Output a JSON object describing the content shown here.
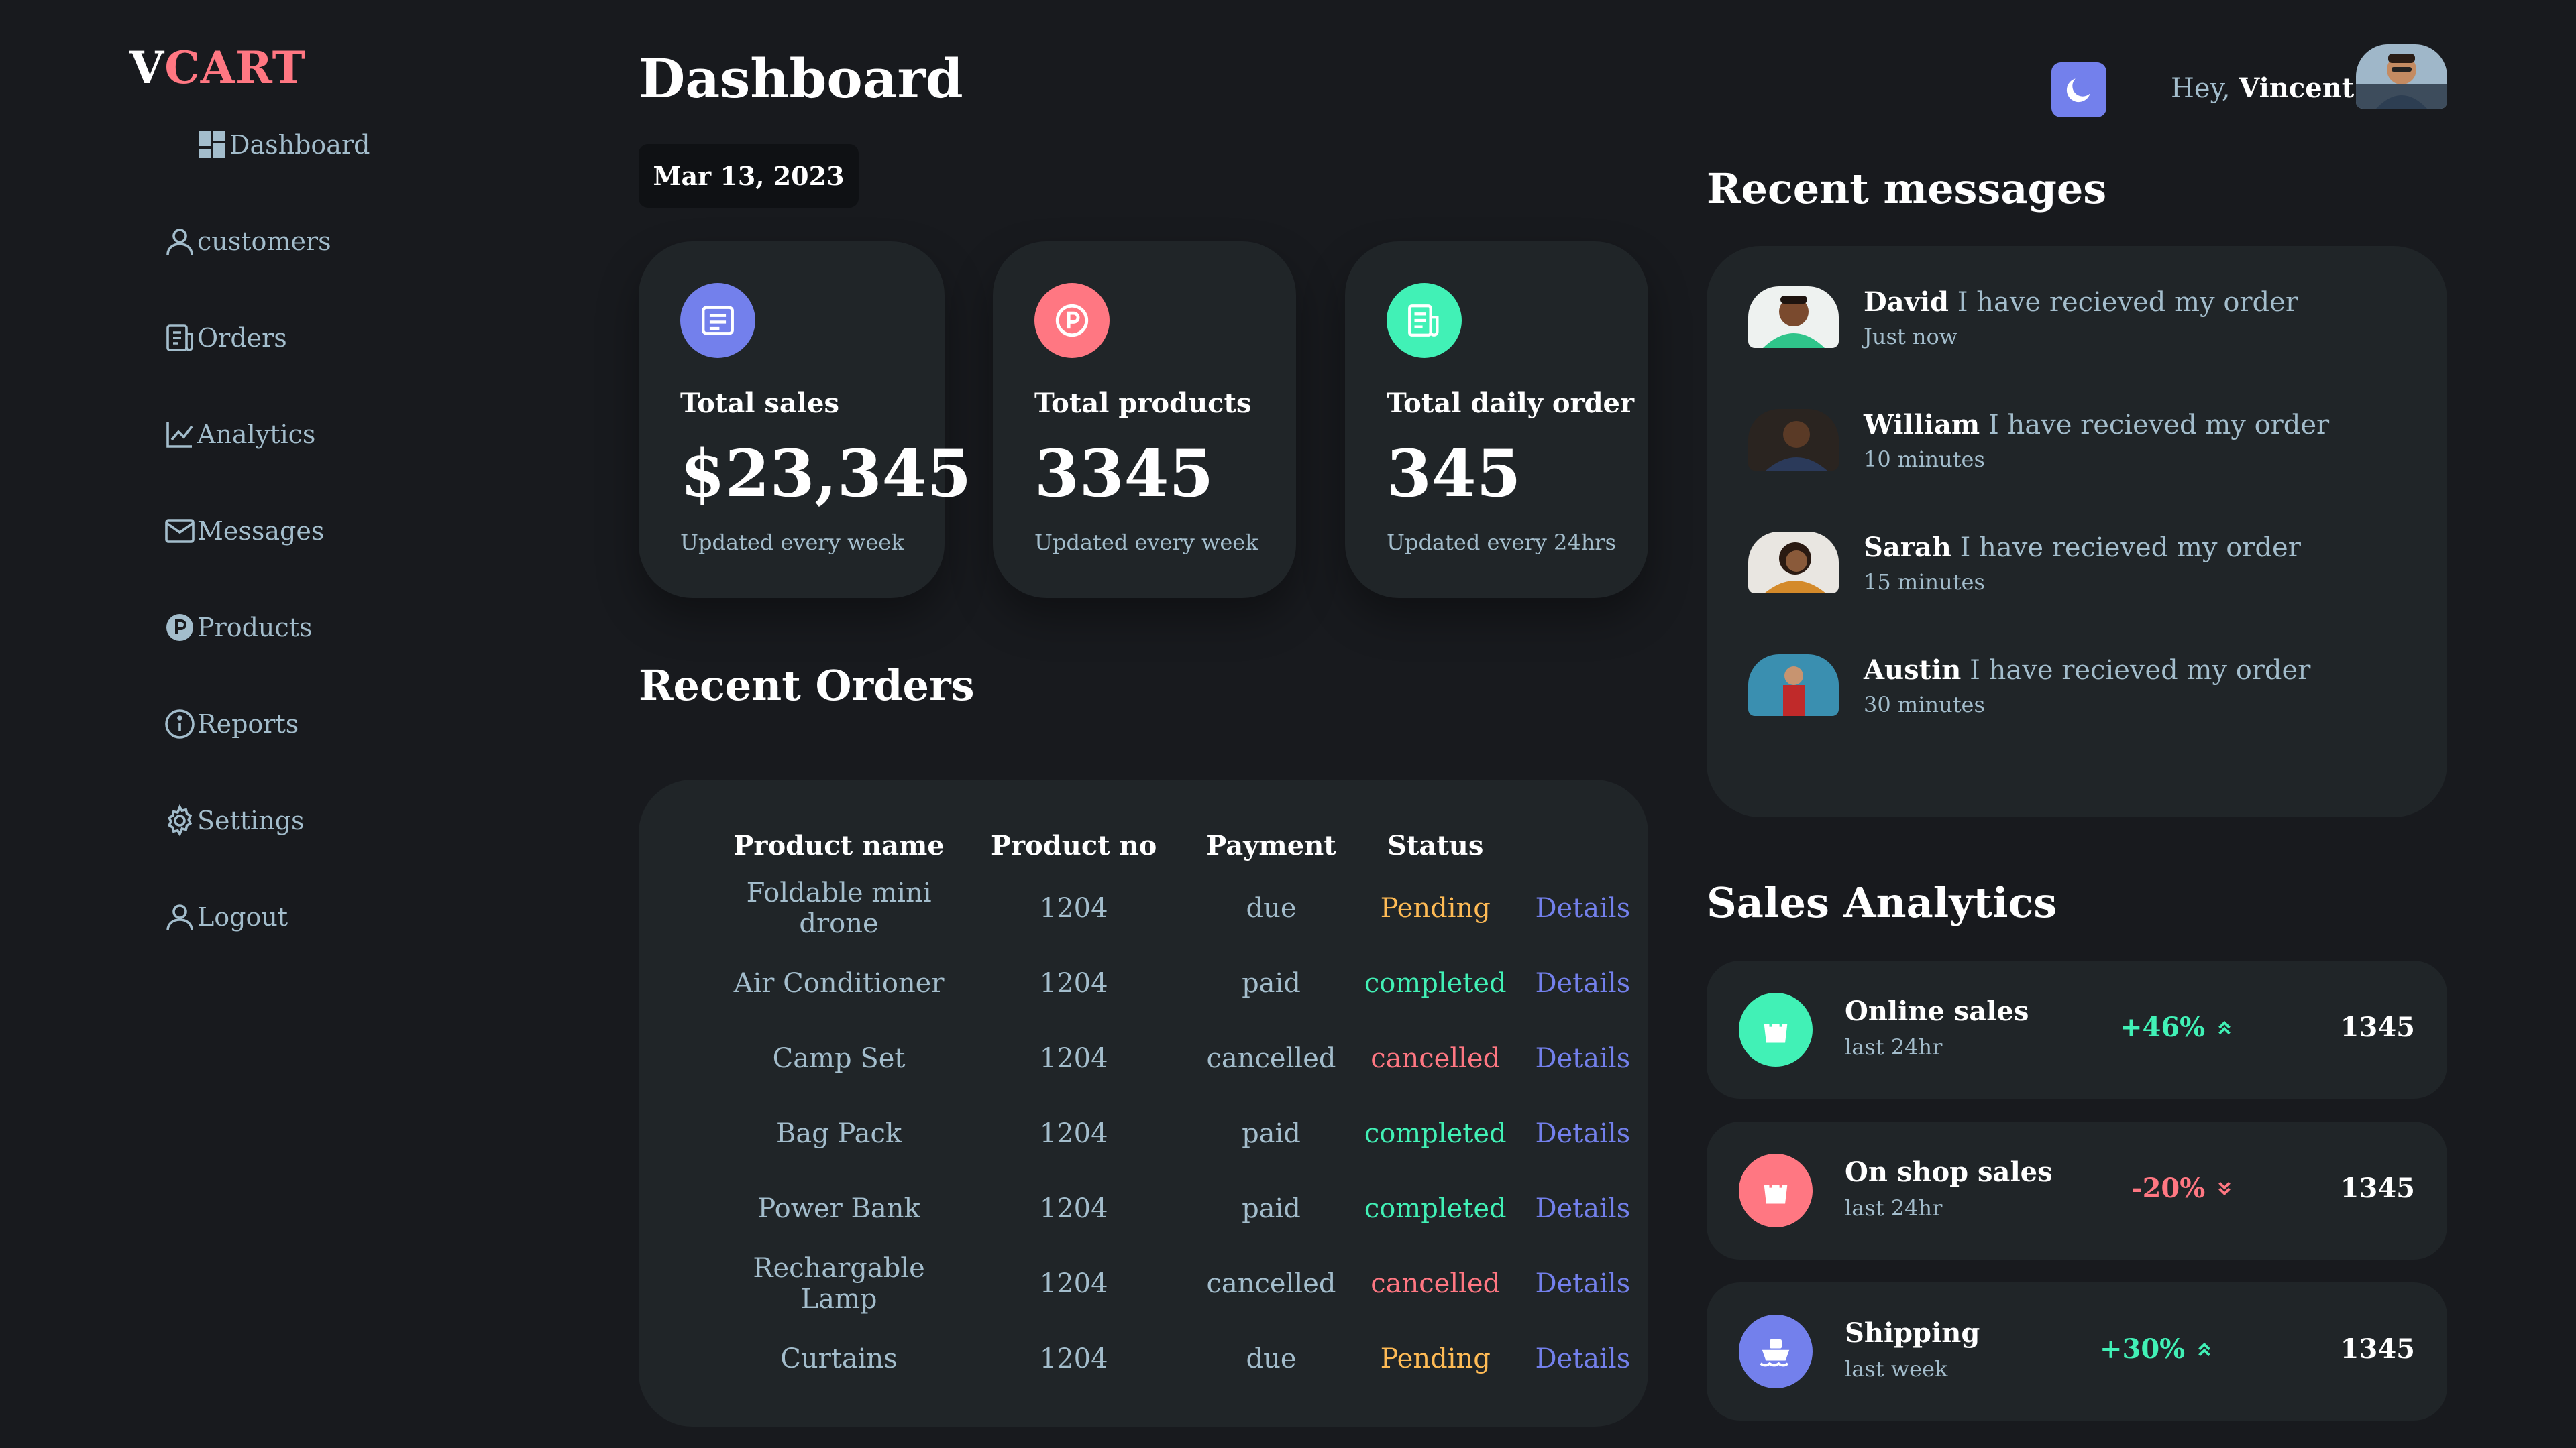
{
  "brand": {
    "prefix": "V",
    "suffix": "CART"
  },
  "sidebar": {
    "items": [
      {
        "label": "Dashboard",
        "icon": "grid-icon"
      },
      {
        "label": "customers",
        "icon": "user-icon"
      },
      {
        "label": "Orders",
        "icon": "receipt-icon"
      },
      {
        "label": "Analytics",
        "icon": "chart-icon"
      },
      {
        "label": "Messages",
        "icon": "mail-icon"
      },
      {
        "label": "Products",
        "icon": "product-p-icon"
      },
      {
        "label": "Reports",
        "icon": "info-icon"
      },
      {
        "label": "Settings",
        "icon": "gear-icon"
      },
      {
        "label": "Logout",
        "icon": "user-icon"
      }
    ]
  },
  "header": {
    "title": "Dashboard",
    "date": "Mar 13, 2023",
    "greeting": "Hey,",
    "user_name": "Vincent"
  },
  "stats": [
    {
      "label": "Total sales",
      "value": "$23,345",
      "note": "Updated every week",
      "color": "#7380ec"
    },
    {
      "label": "Total products",
      "value": "3345",
      "note": "Updated every week",
      "color": "#ff7782"
    },
    {
      "label": "Total daily order",
      "value": "345",
      "note": "Updated every 24hrs",
      "color": "#41f1b6"
    }
  ],
  "orders": {
    "title": "Recent Orders",
    "columns": [
      "Product name",
      "Product no",
      "Payment",
      "Status"
    ],
    "rows": [
      {
        "name": "Foldable mini drone",
        "no": "1204",
        "payment": "due",
        "status": "Pending",
        "status_kind": "pending",
        "action": "Details"
      },
      {
        "name": "Air Conditioner",
        "no": "1204",
        "payment": "paid",
        "status": "completed",
        "status_kind": "completed",
        "action": "Details"
      },
      {
        "name": "Camp Set",
        "no": "1204",
        "payment": "cancelled",
        "status": "cancelled",
        "status_kind": "cancelled",
        "action": "Details"
      },
      {
        "name": "Bag Pack",
        "no": "1204",
        "payment": "paid",
        "status": "completed",
        "status_kind": "completed",
        "action": "Details"
      },
      {
        "name": "Power Bank",
        "no": "1204",
        "payment": "paid",
        "status": "completed",
        "status_kind": "completed",
        "action": "Details"
      },
      {
        "name": "Rechargable Lamp",
        "no": "1204",
        "payment": "cancelled",
        "status": "cancelled",
        "status_kind": "cancelled",
        "action": "Details"
      },
      {
        "name": "Curtains",
        "no": "1204",
        "payment": "due",
        "status": "Pending",
        "status_kind": "pending",
        "action": "Details"
      }
    ]
  },
  "messages": {
    "title": "Recent messages",
    "items": [
      {
        "name": "David",
        "text": "I have recieved my order",
        "time": "Just now"
      },
      {
        "name": "William",
        "text": "I have recieved my order",
        "time": "10 minutes"
      },
      {
        "name": "Sarah",
        "text": "I have recieved my order",
        "time": "15 minutes"
      },
      {
        "name": "Austin",
        "text": "I have recieved my order",
        "time": "30 minutes"
      }
    ]
  },
  "sales": {
    "title": "Sales Analytics",
    "items": [
      {
        "name": "Online sales",
        "period": "last 24hr",
        "change": "+46%",
        "direction": "up",
        "value": "1345",
        "color": "#41f1b6",
        "icon": "shopping-bag-icon"
      },
      {
        "name": "On shop sales",
        "period": "last 24hr",
        "change": "-20%",
        "direction": "down",
        "value": "1345",
        "color": "#ff7782",
        "icon": "shopping-bag-icon"
      },
      {
        "name": "Shipping",
        "period": "last week",
        "change": "+30%",
        "direction": "up",
        "value": "1345",
        "color": "#7380ec",
        "icon": "ship-icon"
      }
    ]
  },
  "colors": {
    "primary": "#7380ec",
    "danger": "#ff7782",
    "success": "#41f1b6",
    "warning": "#ffbb55",
    "background": "#181a1e",
    "card": "#202528"
  }
}
